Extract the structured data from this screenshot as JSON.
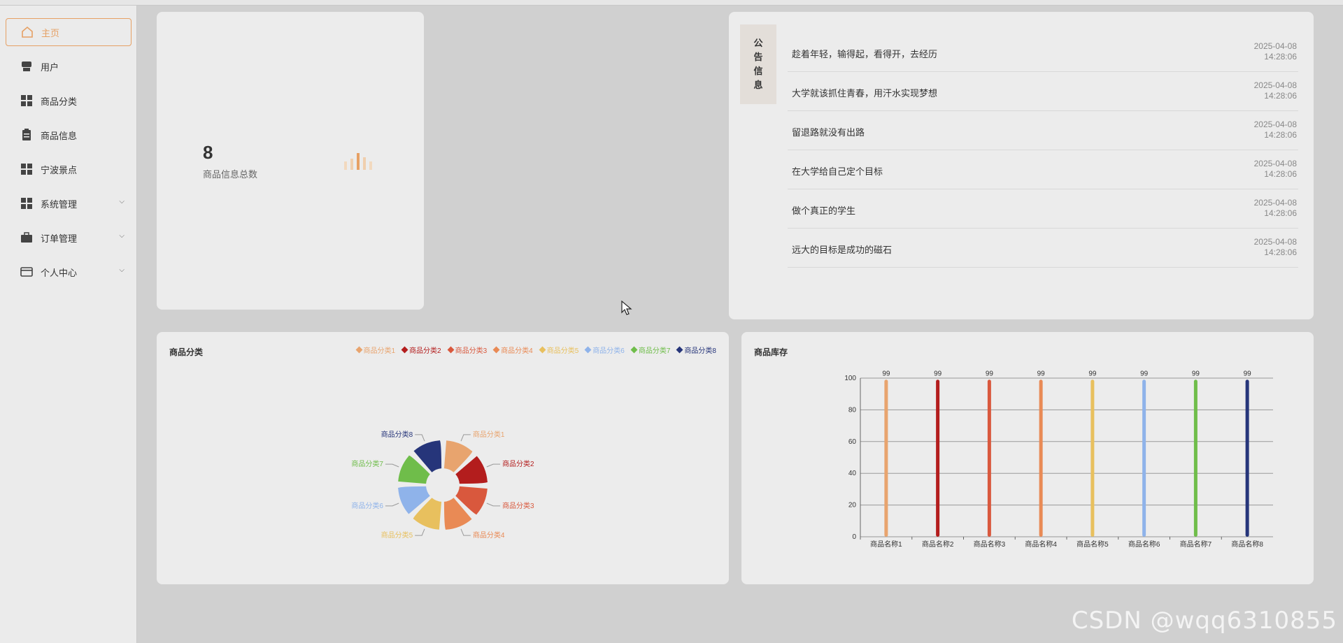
{
  "sidebar": {
    "items": [
      {
        "label": "主页",
        "icon": "home-icon",
        "active": true,
        "has_chevron": false
      },
      {
        "label": "用户",
        "icon": "user-icon",
        "active": false,
        "has_chevron": false
      },
      {
        "label": "商品分类",
        "icon": "grid-icon",
        "active": false,
        "has_chevron": false
      },
      {
        "label": "商品信息",
        "icon": "clipboard-icon",
        "active": false,
        "has_chevron": false
      },
      {
        "label": "宁波景点",
        "icon": "grid-icon",
        "active": false,
        "has_chevron": false
      },
      {
        "label": "系统管理",
        "icon": "grid-icon",
        "active": false,
        "has_chevron": true
      },
      {
        "label": "订单管理",
        "icon": "briefcase-icon",
        "active": false,
        "has_chevron": true
      },
      {
        "label": "个人中心",
        "icon": "card-icon",
        "active": false,
        "has_chevron": true
      }
    ]
  },
  "stat_card": {
    "value": "8",
    "label": "商品信息总数",
    "icon": "bar-chart-icon"
  },
  "notices": {
    "tag_chars": [
      "公",
      "告",
      "信",
      "息"
    ],
    "items": [
      {
        "title": "趁着年轻，输得起，看得开，去经历",
        "date": "2025-04-08",
        "time": "14:28:06"
      },
      {
        "title": "大学就该抓住青春，用汗水实现梦想",
        "date": "2025-04-08",
        "time": "14:28:06"
      },
      {
        "title": "留退路就没有出路",
        "date": "2025-04-08",
        "time": "14:28:06"
      },
      {
        "title": "在大学给自己定个目标",
        "date": "2025-04-08",
        "time": "14:28:06"
      },
      {
        "title": "做个真正的学生",
        "date": "2025-04-08",
        "time": "14:28:06"
      },
      {
        "title": "远大的目标是成功的磁石",
        "date": "2025-04-08",
        "time": "14:28:06"
      }
    ]
  },
  "chart_data": [
    {
      "type": "pie",
      "title": "商品分类",
      "legend_position": "top-right",
      "categories": [
        "商品分类1",
        "商品分类2",
        "商品分类3",
        "商品分类4",
        "商品分类5",
        "商品分类6",
        "商品分类7",
        "商品分类8"
      ],
      "values": [
        1,
        1,
        1,
        1,
        1,
        1,
        1,
        1
      ],
      "colors": [
        "#e8a46e",
        "#b31d1d",
        "#d9583d",
        "#e98a55",
        "#e8c05e",
        "#8fb3ea",
        "#6fbd4a",
        "#26357a"
      ]
    },
    {
      "type": "bar",
      "title": "商品库存",
      "categories": [
        "商品名称1",
        "商品名称2",
        "商品名称3",
        "商品名称4",
        "商品名称5",
        "商品名称6",
        "商品名称7",
        "商品名称8"
      ],
      "values": [
        99,
        99,
        99,
        99,
        99,
        99,
        99,
        99
      ],
      "ylim": [
        0,
        100
      ],
      "yticks": [
        "0",
        "20",
        "40",
        "60",
        "80",
        "100"
      ],
      "grid": true,
      "colors": [
        "#e8a46e",
        "#b31d1d",
        "#d9583d",
        "#e98a55",
        "#e8c05e",
        "#8fb3ea",
        "#6fbd4a",
        "#26357a"
      ]
    }
  ],
  "watermark": "CSDN @wqq6310855"
}
